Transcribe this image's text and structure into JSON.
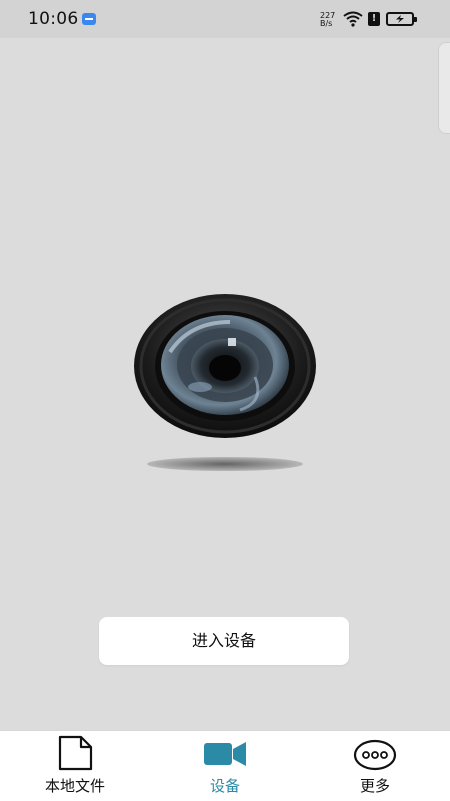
{
  "status_bar": {
    "time": "10:06",
    "network_speed_value": "227",
    "network_speed_unit": "B/s"
  },
  "main": {
    "enter_device_label": "进入设备"
  },
  "bottom_nav": {
    "items": [
      {
        "label": "本地文件",
        "icon": "file-icon",
        "active": false
      },
      {
        "label": "设备",
        "icon": "video-camera-icon",
        "active": true
      },
      {
        "label": "更多",
        "icon": "more-icon",
        "active": false
      }
    ]
  },
  "colors": {
    "accent": "#2b8ba6",
    "background": "#dcdcdc",
    "status_bar": "#d3d3d3",
    "usb_badge": "#3b87f0"
  }
}
